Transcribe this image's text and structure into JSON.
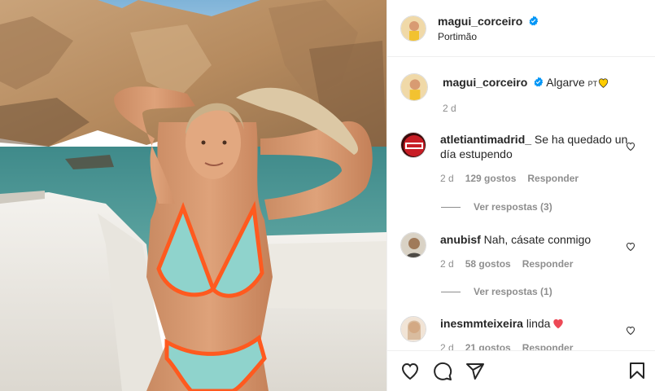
{
  "header": {
    "username": "magui_corceiro",
    "location": "Portimão"
  },
  "caption": {
    "username": "magui_corceiro",
    "text": "Algarve",
    "flag_text": "PT",
    "time": "2 d"
  },
  "comments": [
    {
      "username": "atletiantimadrid_",
      "text": "Se ha quedado un día estupendo",
      "time": "2 d",
      "likes": "129 gostos",
      "reply": "Responder",
      "view_replies": "Ver respostas (3)"
    },
    {
      "username": "anubisf",
      "text": "Nah, cásate conmigo",
      "time": "2 d",
      "likes": "58 gostos",
      "reply": "Responder",
      "view_replies": "Ver respostas (1)"
    },
    {
      "username": "inesmmteixeira",
      "text": "linda",
      "time": "2 d",
      "likes": "21 gostos",
      "reply": "Responder"
    }
  ],
  "colors": {
    "verified": "#0095f6",
    "heart_red": "#ed4956",
    "heart_yellow": "#ffcc00",
    "muted": "#8e8e8e",
    "border": "#efefef"
  },
  "icons": {
    "like": "heart-outline-icon",
    "comment": "speech-bubble-icon",
    "share": "paper-plane-icon",
    "save": "bookmark-icon"
  }
}
